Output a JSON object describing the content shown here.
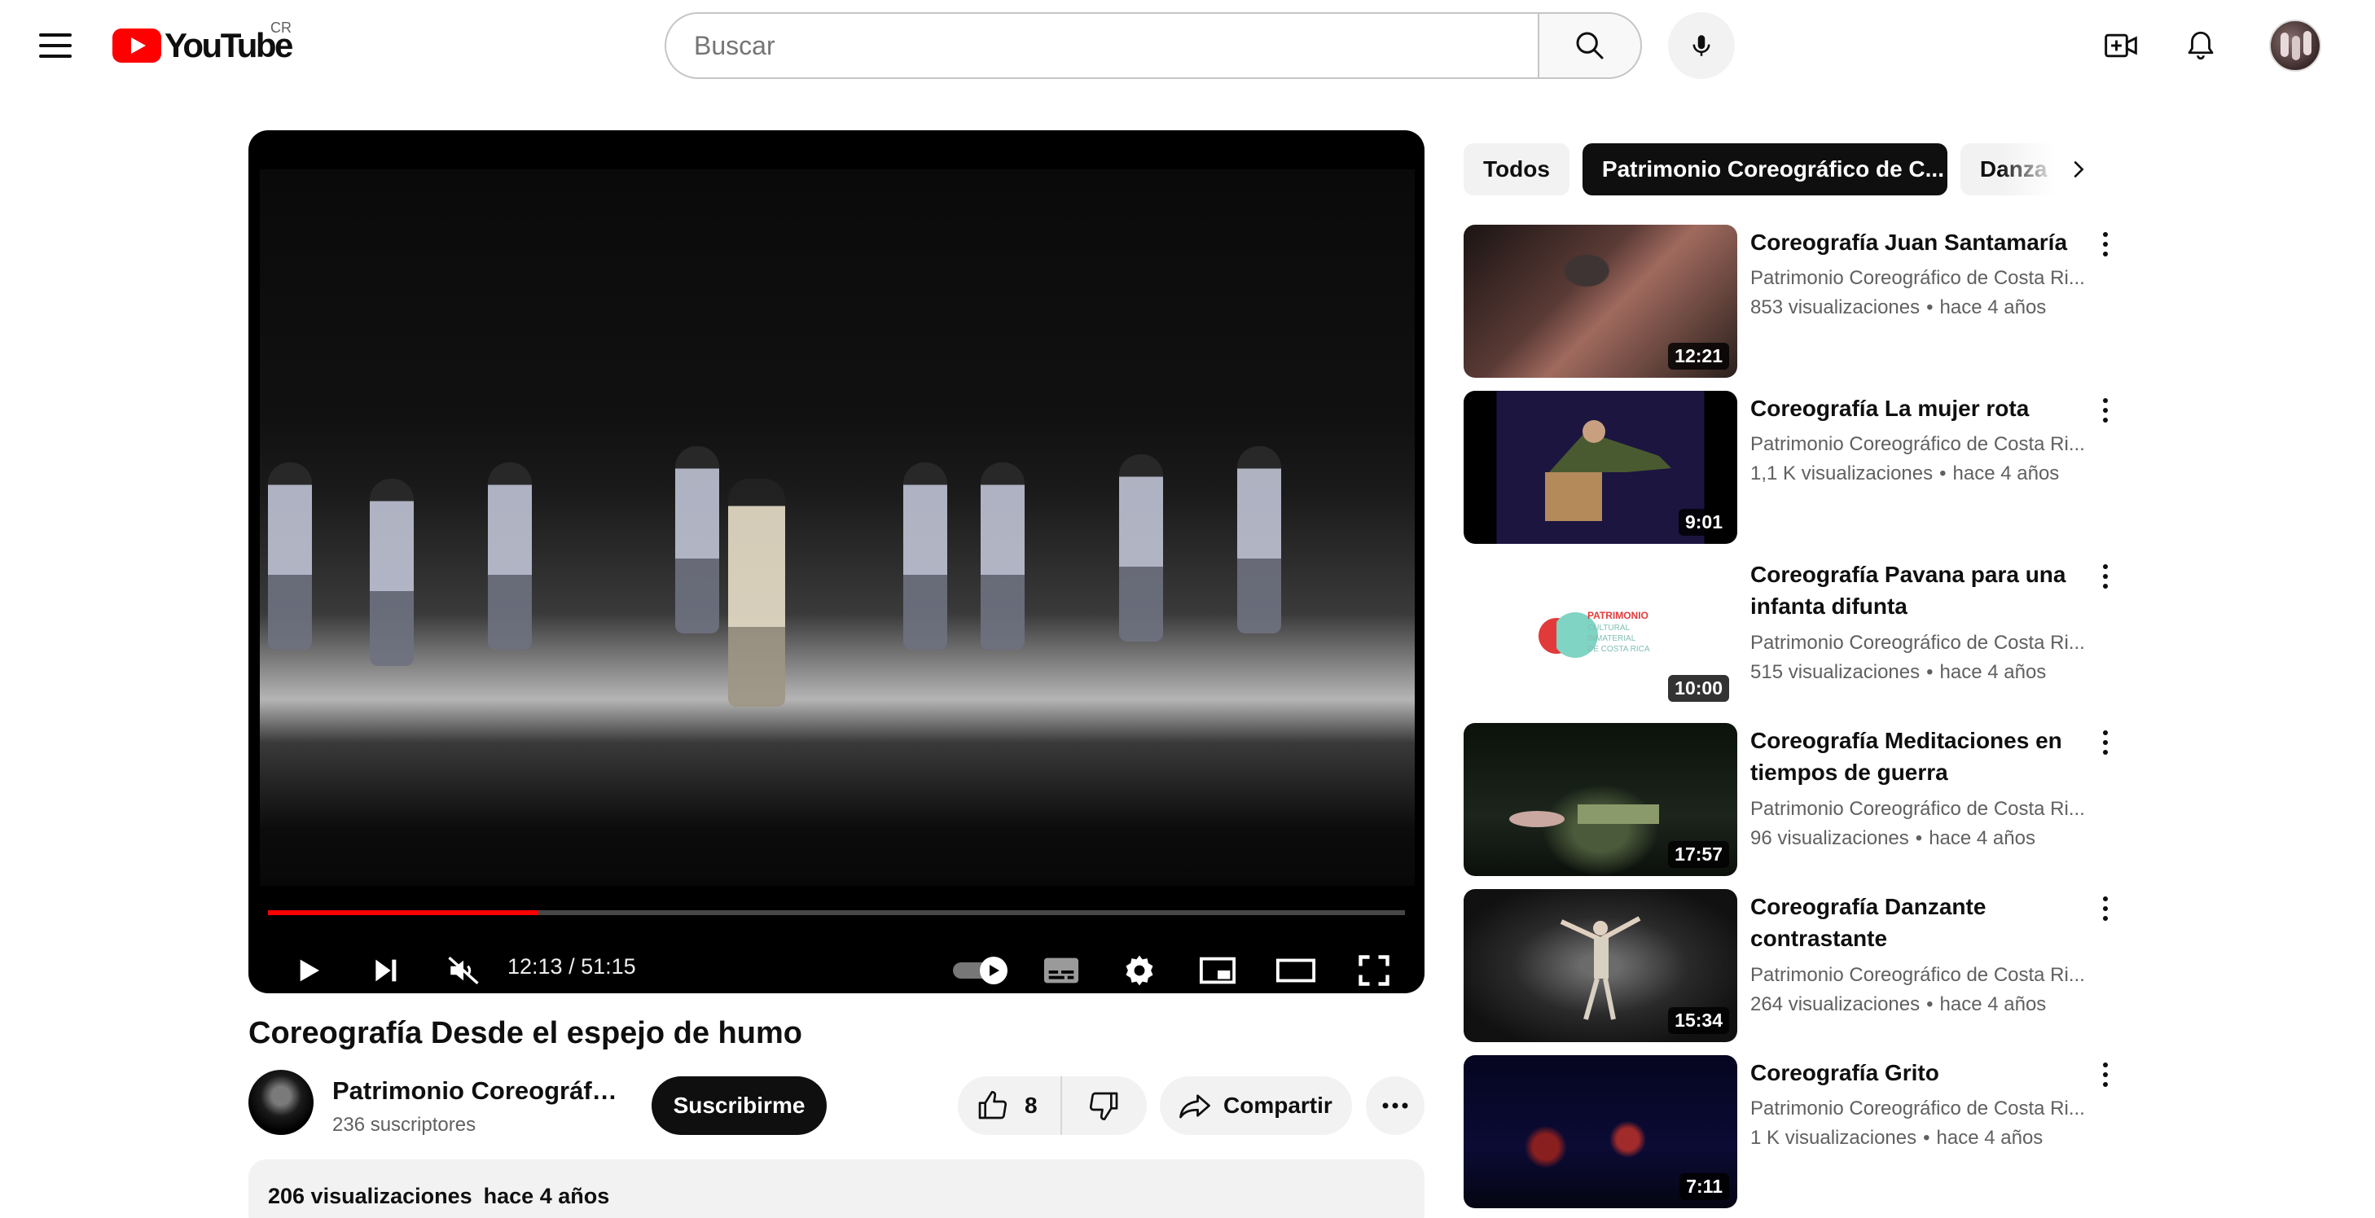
{
  "masthead": {
    "logo_text": "YouTube",
    "region": "CR",
    "search_placeholder": "Buscar",
    "search_value": "",
    "icons": [
      "menu-icon",
      "search-icon",
      "mic-icon",
      "create-video-icon",
      "notifications-bell-icon",
      "account-avatar"
    ]
  },
  "player": {
    "current_time": "12:13",
    "duration": "51:15",
    "time_display": "12:13 / 51:15",
    "progress_fraction": 0.238,
    "autoplay": true,
    "muted": true,
    "progress_color": "#ff0000"
  },
  "video": {
    "title": "Coreografía Desde el espejo de humo",
    "channel_name": "Patrimonio Coreográfico de Costa Rica",
    "channel_subs": "236 suscriptores",
    "subscribe_label": "Suscribirme",
    "likes": "8",
    "share_label": "Compartir",
    "views": "206 visualizaciones",
    "age": "hace 4 años"
  },
  "chips": [
    {
      "label": "Todos",
      "active": false
    },
    {
      "label": "Patrimonio Coreográfico de C...",
      "active": true
    },
    {
      "label": "Danza",
      "active": false
    }
  ],
  "recommendations": [
    {
      "title": "Coreografía Juan Santamaría",
      "channel": "Patrimonio Coreográfico de Costa Ri...",
      "views": "853 visualizaciones",
      "age": "hace 4 años",
      "duration": "12:21"
    },
    {
      "title": "Coreografía La mujer rota",
      "channel": "Patrimonio Coreográfico de Costa Ri...",
      "views": "1,1 K visualizaciones",
      "age": "hace 4 años",
      "duration": "9:01"
    },
    {
      "title": "Coreografía Pavana para una infanta difunta",
      "channel": "Patrimonio Coreográfico de Costa Ri...",
      "views": "515 visualizaciones",
      "age": "hace 4 años",
      "duration": "10:00",
      "thumb_logo": [
        "PATRIMONIO",
        "CULTURAL",
        "INMATERIAL",
        "DE COSTA RICA"
      ]
    },
    {
      "title": "Coreografía Meditaciones en tiempos de guerra",
      "channel": "Patrimonio Coreográfico de Costa Ri...",
      "views": "96 visualizaciones",
      "age": "hace 4 años",
      "duration": "17:57"
    },
    {
      "title": "Coreografía Danzante contrastante",
      "channel": "Patrimonio Coreográfico de Costa Ri...",
      "views": "264 visualizaciones",
      "age": "hace 4 años",
      "duration": "15:34"
    },
    {
      "title": "Coreografía Grito",
      "channel": "Patrimonio Coreográfico de Costa Ri...",
      "views": "1 K visualizaciones",
      "age": "hace 4 años",
      "duration": "7:11"
    }
  ],
  "colors": {
    "brand_red": "#ff0000",
    "chip_active_bg": "#0f0f0f",
    "button_bg": "#f2f2f2",
    "meta_text": "#606060"
  }
}
